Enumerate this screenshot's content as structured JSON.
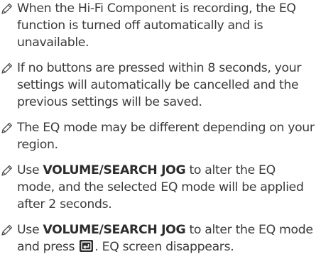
{
  "notes": [
    {
      "text": "When the Hi-Fi Component is recording, the EQ function is turned off automatically and is unavailable."
    },
    {
      "text": "If no buttons are pressed within 8 seconds, your settings will automatically be cancelled and the previous settings will be saved."
    },
    {
      "text": "The EQ mode may be different depending on your region."
    },
    {
      "pre": "Use ",
      "bold": "VOLUME/SEARCH JOG",
      "post": " to alter the EQ mode, and the selected EQ mode will be applied after 2 seconds."
    },
    {
      "pre": "Use ",
      "bold": "VOLUME/SEARCH JOG",
      "mid": " to alter the EQ mode and press ",
      "post": ". EQ screen disappears."
    }
  ],
  "icons": {
    "note": "note-pencil-icon",
    "enter_key": "enter-key-icon"
  },
  "colors": {
    "text": "#3b3b3b",
    "icon": "#4a4a4a"
  }
}
